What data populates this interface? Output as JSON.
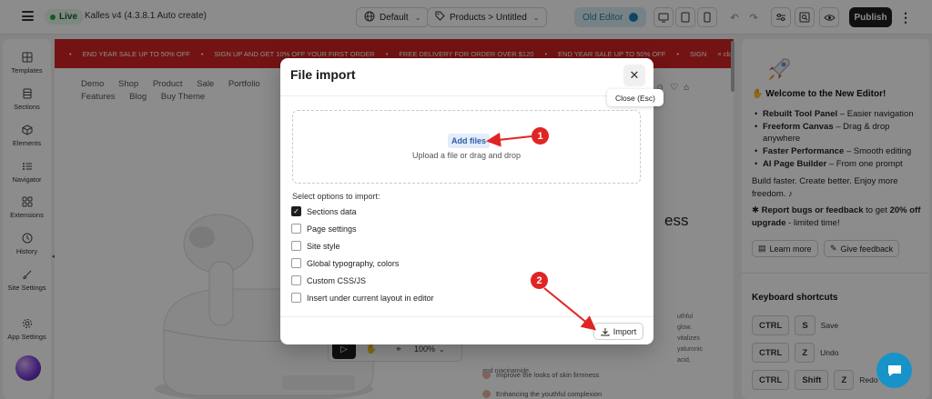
{
  "topbar": {
    "status": "Live",
    "theme_name": "Kalles v4 (4.3.8.1 Auto create)",
    "device_default": "Default",
    "page_path": "Products > Untitled",
    "old_editor": "Old Editor",
    "publish": "Publish"
  },
  "sidebar": {
    "items": [
      {
        "label": "Templates",
        "icon": "grid-icon"
      },
      {
        "label": "Sections",
        "icon": "sections-icon"
      },
      {
        "label": "Elements",
        "icon": "cube-icon"
      },
      {
        "label": "Navigator",
        "icon": "list-icon"
      },
      {
        "label": "Extensions",
        "icon": "apps-icon"
      },
      {
        "label": "History",
        "icon": "clock-icon"
      },
      {
        "label": "Site Settings",
        "icon": "brush-icon"
      },
      {
        "label": "App Settings",
        "icon": "gear-icon"
      }
    ]
  },
  "canvas": {
    "promo": [
      "END YEAR SALE UP TO 50% OFF",
      "SIGN UP AND GET 10% OFF YOUR FIRST ORDER",
      "FREE DELIVERY FOR ORDER OVER $120",
      "END YEAR SALE UP TO 50% OFF",
      "SIGN",
      "close"
    ],
    "nav": [
      "Demo",
      "Shop",
      "Product",
      "Sale",
      "Portfolio",
      "Features",
      "Blog",
      "Buy Theme"
    ],
    "hero_title_fragment": "ess",
    "hero_text_lines": [
      "uthful glow.",
      "vitalizes",
      "yaluronic acid,",
      "and niacinamide."
    ],
    "features": [
      "Improve the looks of skin firmness",
      "Enhancing the youthful complexion"
    ],
    "zoom": "100%"
  },
  "right_panel": {
    "welcome": "Welcome to the New Editor!",
    "features": [
      {
        "bold": "Rebuilt Tool Panel",
        "text": " – Easier navigation"
      },
      {
        "bold": "Freeform Canvas",
        "text": " – Drag & drop anywhere"
      },
      {
        "bold": "Faster Performance",
        "text": " – Smooth editing"
      },
      {
        "bold": "AI Page Builder",
        "text": " – From one prompt"
      }
    ],
    "build_text": "Build faster. Create better. Enjoy more freedom.",
    "report_bold1": "Report bugs or feedback",
    "report_mid": " to get ",
    "report_bold2": "20% off upgrade",
    "report_tail": " - limited time!",
    "learn_more": "Learn more",
    "give_feedback": "Give feedback",
    "shortcuts_title": "Keyboard shortcuts",
    "shortcuts": [
      {
        "keys": [
          "CTRL",
          "S"
        ],
        "label": "Save"
      },
      {
        "keys": [
          "CTRL",
          "Z"
        ],
        "label": "Undo"
      },
      {
        "keys": [
          "CTRL",
          "Shift",
          "Z"
        ],
        "label": "Redo"
      }
    ]
  },
  "modal": {
    "title": "File import",
    "close_tooltip": "Close (Esc)",
    "add_files": "Add files",
    "drop_hint": "Upload a file or drag and drop",
    "options_label": "Select options to import:",
    "options": [
      {
        "label": "Sections data",
        "checked": true
      },
      {
        "label": "Page settings",
        "checked": false
      },
      {
        "label": "Site style",
        "checked": false
      },
      {
        "label": "Global typography, colors",
        "checked": false
      },
      {
        "label": "Custom CSS/JS",
        "checked": false
      },
      {
        "label": "Insert under current layout in editor",
        "checked": false
      }
    ],
    "import": "Import"
  },
  "annotations": {
    "step1": "1",
    "step2": "2"
  },
  "colors": {
    "promo_red": "#d42323",
    "accent_blue": "#1793c8",
    "annotation_red": "#e02424",
    "live_green": "#26a541"
  }
}
